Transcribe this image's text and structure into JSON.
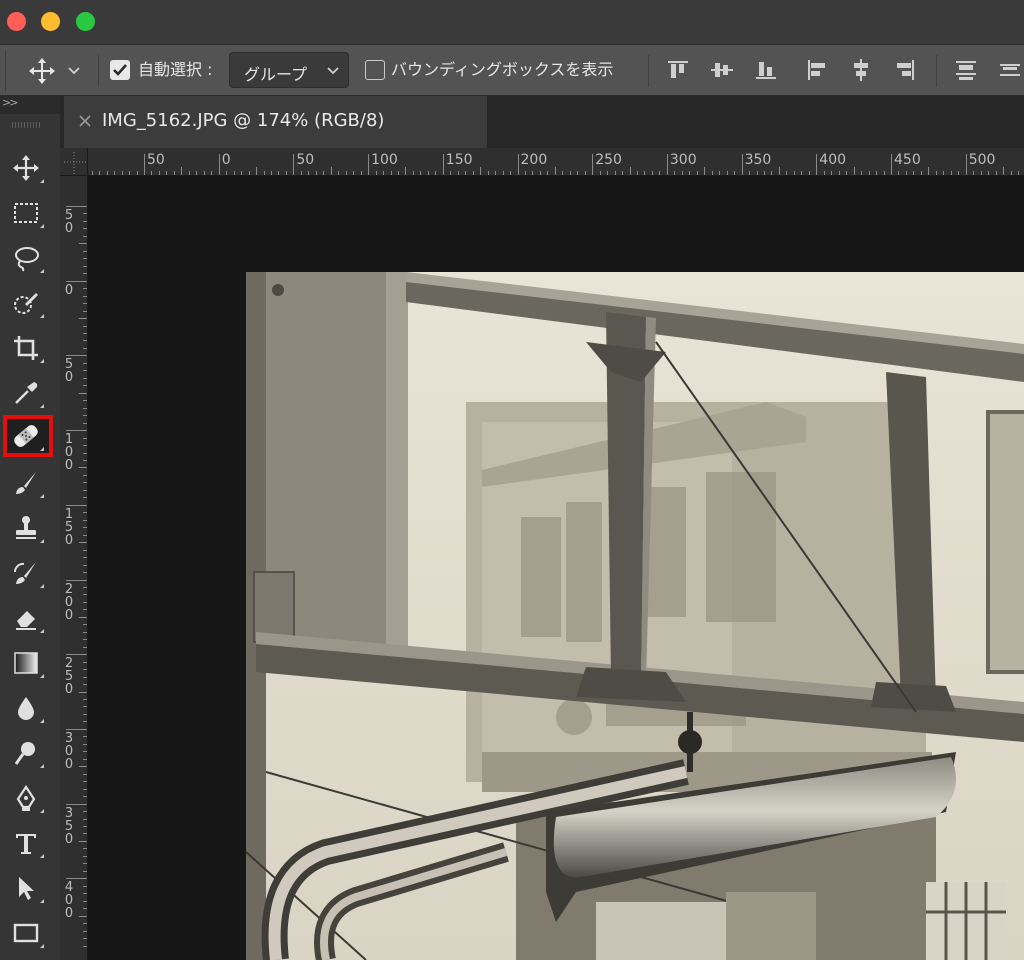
{
  "window": {
    "traffic_lights": [
      "close",
      "minimize",
      "zoom"
    ]
  },
  "options_bar": {
    "tool_icon": "move-icon",
    "auto_select": {
      "checked": true,
      "label": "自動選択 :"
    },
    "auto_select_target": {
      "value": "グループ"
    },
    "bounding_box": {
      "checked": false,
      "label": "バウンディングボックスを表示"
    },
    "align_icons": [
      "align-top-icon",
      "align-vertical-center-icon",
      "align-bottom-icon",
      "align-left-icon",
      "align-horizontal-center-icon",
      "align-right-icon",
      "distribute-top-icon",
      "distribute-vertical-center-icon"
    ]
  },
  "toolbar": {
    "header": ">>",
    "tools": [
      {
        "name": "move-tool",
        "icon": "move-icon"
      },
      {
        "name": "marquee-tool",
        "icon": "rectangular-marquee-icon"
      },
      {
        "name": "lasso-tool",
        "icon": "lasso-icon"
      },
      {
        "name": "quick-selection-tool",
        "icon": "quick-selection-icon"
      },
      {
        "name": "crop-tool",
        "icon": "crop-icon"
      },
      {
        "name": "eyedropper-tool",
        "icon": "eyedropper-icon"
      },
      {
        "name": "healing-brush-tool",
        "icon": "bandage-icon",
        "highlighted": true
      },
      {
        "name": "brush-tool",
        "icon": "brush-icon"
      },
      {
        "name": "clone-stamp-tool",
        "icon": "stamp-icon"
      },
      {
        "name": "history-brush-tool",
        "icon": "history-brush-icon"
      },
      {
        "name": "eraser-tool",
        "icon": "eraser-icon"
      },
      {
        "name": "gradient-tool",
        "icon": "gradient-icon"
      },
      {
        "name": "blur-tool",
        "icon": "blur-drop-icon"
      },
      {
        "name": "dodge-tool",
        "icon": "dodge-icon"
      },
      {
        "name": "pen-tool",
        "icon": "pen-icon"
      },
      {
        "name": "type-tool",
        "icon": "type-icon"
      },
      {
        "name": "path-selection-tool",
        "icon": "path-selection-icon"
      },
      {
        "name": "rectangle-tool",
        "icon": "rectangle-icon"
      }
    ],
    "highlight_color": "#e20f0f"
  },
  "document_tab": {
    "title": "IMG_5162.JPG @ 174% (RGB/8)",
    "close_icon": "close-icon"
  },
  "rulers": {
    "horizontal": [
      "50",
      "0",
      "50",
      "100",
      "150",
      "200",
      "250",
      "300",
      "350",
      "400",
      "450",
      "500"
    ],
    "vertical": [
      "50",
      "0",
      "50",
      "100",
      "150",
      "200",
      "250",
      "300",
      "350",
      "400"
    ]
  },
  "canvas": {
    "image": "sepia-photo-street-sign-frame"
  }
}
